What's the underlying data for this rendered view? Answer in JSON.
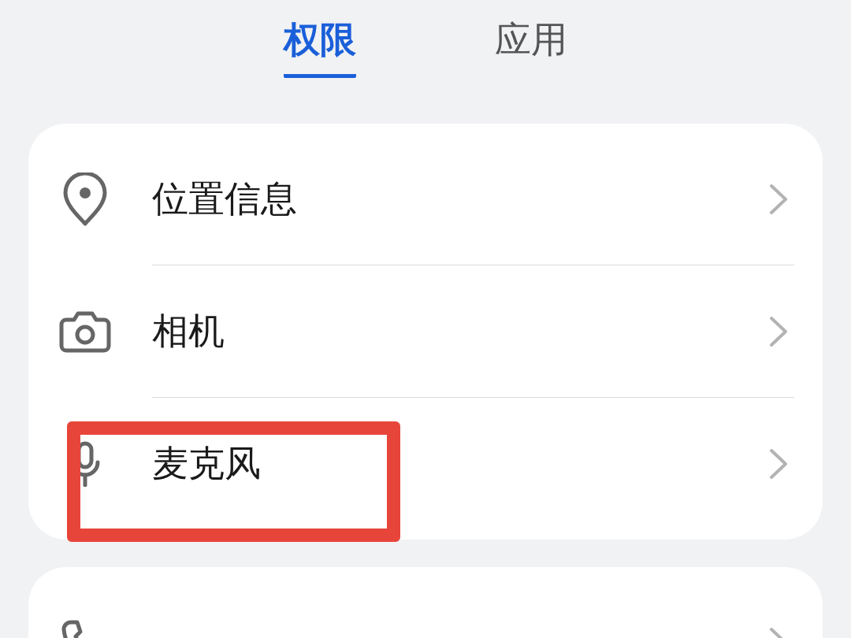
{
  "tabs": [
    {
      "label": "权限",
      "selected": true
    },
    {
      "label": "应用",
      "selected": false
    }
  ],
  "groups": [
    {
      "items": [
        {
          "kind": "location",
          "label": "位置信息",
          "highlighted": false
        },
        {
          "kind": "camera",
          "label": "相机",
          "highlighted": false
        },
        {
          "kind": "microphone",
          "label": "麦克风",
          "highlighted": true
        }
      ]
    },
    {
      "items": [
        {
          "kind": "phone",
          "highlighted": false
        }
      ]
    }
  ]
}
